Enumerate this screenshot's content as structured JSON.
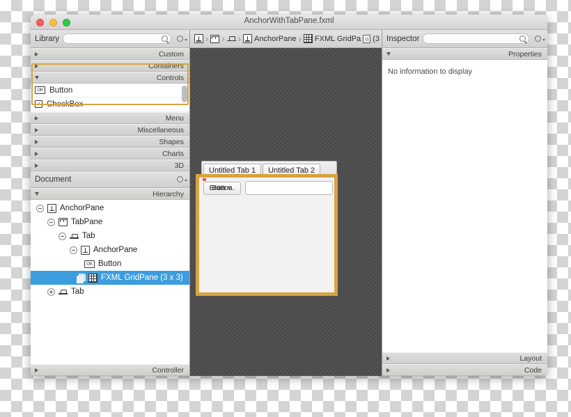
{
  "window": {
    "title": "AnchorWithTabPane.fxml",
    "traffic_lights": [
      "close-red",
      "minimize-yellow",
      "zoom-green"
    ]
  },
  "library": {
    "title": "Library",
    "search_placeholder": "",
    "search_value": "",
    "gear_icon": "gear-icon",
    "search_icon": "search-icon",
    "sections": [
      {
        "label": "Custom",
        "expanded": false
      },
      {
        "label": "Containers",
        "expanded": false
      },
      {
        "label": "Controls",
        "expanded": true
      }
    ],
    "items": [
      {
        "label": "Button",
        "icon": "ok-button-icon"
      },
      {
        "label": "CheckBox",
        "icon": "checkbox-icon"
      }
    ],
    "sections_after": [
      {
        "label": "Menu",
        "expanded": false
      },
      {
        "label": "Miscellaneous",
        "expanded": false
      },
      {
        "label": "Shapes",
        "expanded": false
      },
      {
        "label": "Charts",
        "expanded": false
      },
      {
        "label": "3D",
        "expanded": false
      }
    ]
  },
  "document": {
    "title": "Document",
    "gear_icon": "gear-icon",
    "hierarchy_label": "Hierarchy",
    "controller_label": "Controller",
    "tree": [
      {
        "label": "AnchorPane",
        "icon": "anchorpane-icon",
        "indent": 0,
        "disclosure": "minus",
        "selected": false
      },
      {
        "label": "TabPane",
        "icon": "tabpane-icon",
        "indent": 1,
        "disclosure": "minus",
        "selected": false
      },
      {
        "label": "Tab",
        "icon": "tab-icon",
        "indent": 2,
        "disclosure": "minus",
        "selected": false
      },
      {
        "label": "AnchorPane",
        "icon": "anchorpane-icon",
        "indent": 3,
        "disclosure": "minus",
        "selected": false
      },
      {
        "label": "Button",
        "icon": "ok-button-icon",
        "indent": 4,
        "disclosure": "none",
        "selected": false
      },
      {
        "label": "FXML GridPane (3 x 3)",
        "icon": "grid-icon",
        "indent": 4,
        "disclosure": "none",
        "selected": true
      },
      {
        "label": "Tab",
        "icon": "tab-icon",
        "indent": 2,
        "disclosure": "plus",
        "selected": false
      }
    ]
  },
  "breadcrumb": {
    "items": [
      {
        "label": "",
        "icon": "anchorpane-icon"
      },
      {
        "label": "",
        "icon": "tabpane-icon"
      },
      {
        "label": "",
        "icon": "tab-icon"
      },
      {
        "label": "AnchorPane",
        "icon": "anchorpane-icon"
      },
      {
        "label": "FXML GridPa",
        "icon": "grid-icon",
        "trailing_icon": "document-icon",
        "suffix": "(3"
      }
    ],
    "separator": "›"
  },
  "canvas": {
    "tabs": [
      {
        "label": "Untitled Tab 1",
        "selected": true
      },
      {
        "label": "Untitled Tab 2",
        "selected": false
      }
    ],
    "button_label": "Button",
    "overlap_label": "Enter v..",
    "textfield_value": "",
    "selection_color": "#d6a440"
  },
  "inspector": {
    "title": "Inspector",
    "search_icon": "search-icon",
    "gear_icon": "gear-icon",
    "properties_label": "Properties",
    "empty_message": "No information to display",
    "layout_label": "Layout",
    "code_label": "Code"
  }
}
